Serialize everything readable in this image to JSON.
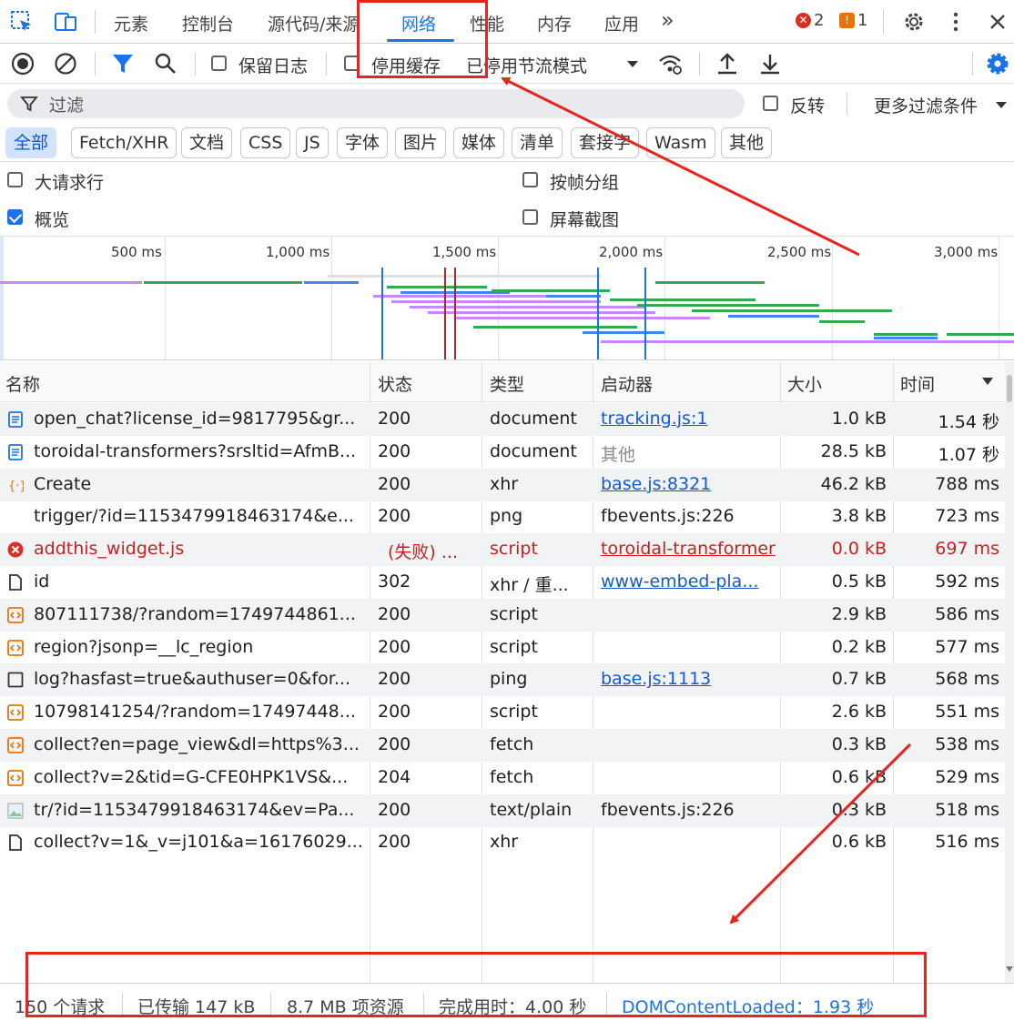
{
  "tabs": [
    "元素",
    "控制台",
    "源代码/来源",
    "网络",
    "性能",
    "内存",
    "应用"
  ],
  "active_tab": "网络",
  "errors_count": "2",
  "warnings_count": "1",
  "toolbar": {
    "preserve_log": "保留日志",
    "disable_cache": "停用缓存",
    "throttle": "已停用节流模式"
  },
  "filter": {
    "placeholder": "过滤",
    "invert": "反转",
    "more_filters": "更多过滤条件"
  },
  "type_filters": [
    "全部",
    "Fetch/XHR",
    "文档",
    "CSS",
    "JS",
    "字体",
    "图片",
    "媒体",
    "清单",
    "套接字",
    "Wasm",
    "其他"
  ],
  "options": {
    "big_rows": "大请求行",
    "group_by_frame": "按帧分组",
    "overview": "概览",
    "screenshots": "屏幕截图"
  },
  "overview_ticks": [
    "500 ms",
    "1,000 ms",
    "1,500 ms",
    "2,000 ms",
    "2,500 ms",
    "3,000 ms"
  ],
  "columns": [
    "名称",
    "状态",
    "类型",
    "启动器",
    "大小",
    "时间"
  ],
  "rows": [
    {
      "name": "open_chat?license_id=9817795&gr...",
      "status": "200",
      "type": "document",
      "initiator": "tracking.js:1",
      "size": "1.0 kB",
      "time": "1.54 秒",
      "icon": "document-icon"
    },
    {
      "name": "toroidal-transformers?srsltid=AfmB...",
      "status": "200",
      "type": "document",
      "initiator": "其他",
      "size": "28.5 kB",
      "time": "1.07 秒",
      "icon": "document-icon"
    },
    {
      "name": "Create",
      "status": "200",
      "type": "xhr",
      "initiator": "base.js:8321",
      "size": "46.2 kB",
      "time": "788 ms",
      "icon": "xhr-icon"
    },
    {
      "name": "trigger/?id=1153479918463174&e...",
      "status": "200",
      "type": "png",
      "initiator": "fbevents.js:226",
      "size": "3.8 kB",
      "time": "723 ms",
      "icon": "none"
    },
    {
      "name": "addthis_widget.js",
      "status": "(失败) ...",
      "type": "script",
      "initiator": "toroidal-transformer",
      "size": "0.0 kB",
      "time": "697 ms",
      "icon": "error-icon"
    },
    {
      "name": "id",
      "status": "302",
      "type": "xhr / 重...",
      "initiator": "www-embed-pla...",
      "size": "0.5 kB",
      "time": "592 ms",
      "icon": "file-icon"
    },
    {
      "name": "807111738/?random=1749744861...",
      "status": "200",
      "type": "script",
      "initiator": "",
      "size": "2.9 kB",
      "time": "586 ms",
      "icon": "script-icon"
    },
    {
      "name": "region?jsonp=__lc_region",
      "status": "200",
      "type": "script",
      "initiator": "",
      "size": "0.2 kB",
      "time": "577 ms",
      "icon": "script-icon"
    },
    {
      "name": "log?hasfast=true&authuser=0&for...",
      "status": "200",
      "type": "ping",
      "initiator": "base.js:1113",
      "size": "0.7 kB",
      "time": "568 ms",
      "icon": "checkbox-icon"
    },
    {
      "name": "10798141254/?random=17497448...",
      "status": "200",
      "type": "script",
      "initiator": "",
      "size": "2.6 kB",
      "time": "551 ms",
      "icon": "script-icon"
    },
    {
      "name": "collect?en=page_view&dl=https%3...",
      "status": "200",
      "type": "fetch",
      "initiator": "",
      "size": "0.3 kB",
      "time": "538 ms",
      "icon": "script-icon"
    },
    {
      "name": "collect?v=2&tid=G-CFE0HPK1VS&...",
      "status": "204",
      "type": "fetch",
      "initiator": "",
      "size": "0.6 kB",
      "time": "529 ms",
      "icon": "script-icon"
    },
    {
      "name": "tr/?id=1153479918463174&ev=Pa...",
      "status": "200",
      "type": "text/plain",
      "initiator": "fbevents.js:226",
      "size": "0.3 kB",
      "time": "518 ms",
      "icon": "image-icon"
    },
    {
      "name": "collect?v=1&_v=j101&a=16176029...",
      "status": "200",
      "type": "xhr",
      "initiator": "",
      "size": "0.6 kB",
      "time": "516 ms",
      "icon": "file-icon"
    }
  ],
  "footer": {
    "requests": "150 个请求",
    "transferred": "已传输 147 kB",
    "resources": "8.7 MB 项资源",
    "finish": "完成用时：4.00 秒",
    "dcl": "DOMContentLoaded：1.93 秒"
  },
  "colors": {
    "accent": "#1a73e8",
    "error": "#c5221f",
    "annotation": "#e8241e"
  }
}
